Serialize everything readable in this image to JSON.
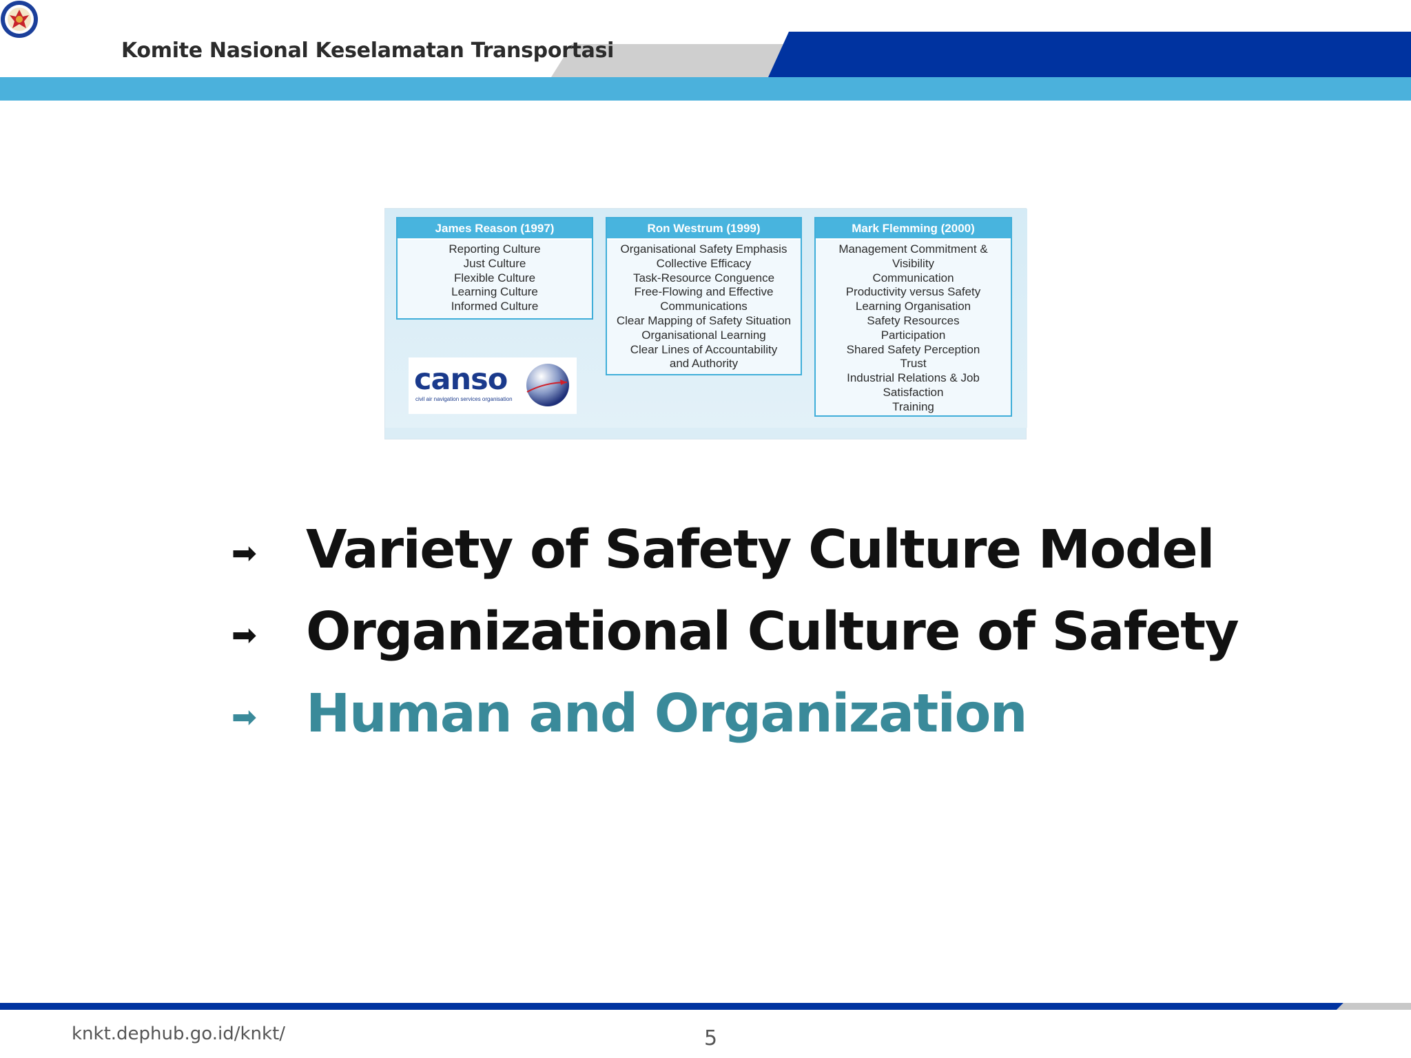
{
  "header": {
    "org_name": "Komite Nasional Keselamatan Transportasi",
    "colors": {
      "dark_blue": "#0033a0",
      "light_blue": "#4bb1dc",
      "grey": "#cfcfcf"
    }
  },
  "figure": {
    "columns": [
      {
        "title": "James Reason (1997)",
        "items": [
          "Reporting Culture",
          "Just Culture",
          "Flexible Culture",
          "Learning Culture",
          "Informed Culture"
        ]
      },
      {
        "title": "Ron Westrum (1999)",
        "items": [
          "Organisational Safety Emphasis",
          "Collective Efficacy",
          "Task-Resource Conguence",
          "Free-Flowing and Effective",
          "Communications",
          "Clear Mapping of Safety Situation",
          "Organisational Learning",
          "Clear Lines of Accountability",
          "and Authority"
        ]
      },
      {
        "title": "Mark Flemming (2000)",
        "items": [
          "Management Commitment &",
          "Visibility",
          "Communication",
          "Productivity versus Safety",
          "Learning Organisation",
          "Safety Resources",
          "Participation",
          "Shared Safety Perception",
          "Trust",
          "Industrial Relations & Job",
          "Satisfaction",
          "Training"
        ]
      }
    ],
    "logo": {
      "word": "canso",
      "tagline": "civil air navigation services organisation"
    }
  },
  "bullets": [
    {
      "arrow": "➡",
      "text": "Variety of Safety Culture Model",
      "active": false
    },
    {
      "arrow": "➡",
      "text": "Organizational Culture of Safety",
      "active": false
    },
    {
      "arrow": "➡",
      "text": "Human and Organization",
      "active": true
    }
  ],
  "footer": {
    "url": "knkt.dephub.go.id/knkt/",
    "page_number": "5"
  }
}
